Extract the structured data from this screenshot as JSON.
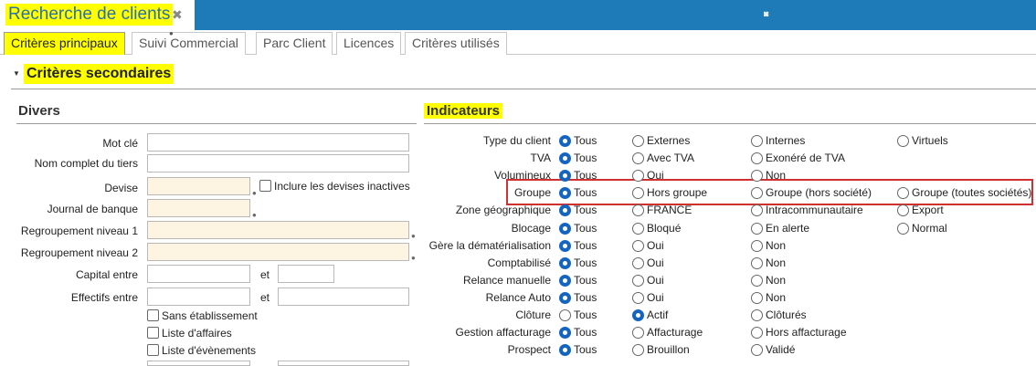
{
  "window": {
    "title": "Recherche de clients"
  },
  "tabs": [
    {
      "label": "Critères principaux",
      "active": true
    },
    {
      "label": "Suivi Commercial"
    },
    {
      "label": "Parc Client"
    },
    {
      "label": "Licences"
    },
    {
      "label": "Critères utilisés"
    }
  ],
  "section": {
    "title": "Critères secondaires"
  },
  "divers": {
    "title": "Divers",
    "fields": [
      {
        "label": "Mot clé",
        "value": ""
      },
      {
        "label": "Nom complet du tiers",
        "value": ""
      },
      {
        "label": "Devise",
        "value": ""
      },
      {
        "label": "Journal de banque",
        "value": ""
      },
      {
        "label": "Regroupement niveau 1",
        "value": ""
      },
      {
        "label": "Regroupement niveau 2",
        "value": ""
      },
      {
        "label": "Capital entre",
        "value": "",
        "and_label": "et",
        "value2": ""
      },
      {
        "label": "Effectifs entre",
        "value": "",
        "and_label": "et",
        "value2": ""
      }
    ],
    "checkboxes": {
      "inactive_currencies": "Inclure les devises inactives",
      "no_establishment": "Sans établissement",
      "business_list": "Liste d'affaires",
      "events_list": "Liste d'évènements"
    }
  },
  "indicateurs": {
    "title": "Indicateurs",
    "rows": [
      {
        "label": "Type du client",
        "options": [
          "Tous",
          "Externes",
          "Internes",
          "Virtuels"
        ],
        "selected": 0
      },
      {
        "label": "TVA",
        "options": [
          "Tous",
          "Avec TVA",
          "Exonéré de TVA"
        ],
        "selected": 0
      },
      {
        "label": "Volumineux",
        "options": [
          "Tous",
          "Oui",
          "Non"
        ],
        "selected": 0
      },
      {
        "label": "Groupe",
        "options": [
          "Tous",
          "Hors groupe",
          "Groupe (hors société)",
          "Groupe (toutes sociétés)"
        ],
        "selected": 0
      },
      {
        "label": "Zone géographique",
        "options": [
          "Tous",
          "FRANCE",
          "Intracommunautaire",
          "Export"
        ],
        "selected": 0
      },
      {
        "label": "Blocage",
        "options": [
          "Tous",
          "Bloqué",
          "En alerte",
          "Normal"
        ],
        "selected": 0
      },
      {
        "label": "Gère la dématérialisation",
        "options": [
          "Tous",
          "Oui",
          "Non"
        ],
        "selected": 0
      },
      {
        "label": "Comptabilisé",
        "options": [
          "Tous",
          "Oui",
          "Non"
        ],
        "selected": 0
      },
      {
        "label": "Relance manuelle",
        "options": [
          "Tous",
          "Oui",
          "Non"
        ],
        "selected": 0
      },
      {
        "label": "Relance Auto",
        "options": [
          "Tous",
          "Oui",
          "Non"
        ],
        "selected": 0
      },
      {
        "label": "Clôture",
        "options": [
          "Tous",
          "Actif",
          "Clôturés"
        ],
        "selected": 1
      },
      {
        "label": "Gestion affacturage",
        "options": [
          "Tous",
          "Affacturage",
          "Hors affacturage"
        ],
        "selected": 0
      },
      {
        "label": "Prospect",
        "options": [
          "Tous",
          "Brouillon",
          "Validé"
        ],
        "selected": 0
      }
    ]
  }
}
